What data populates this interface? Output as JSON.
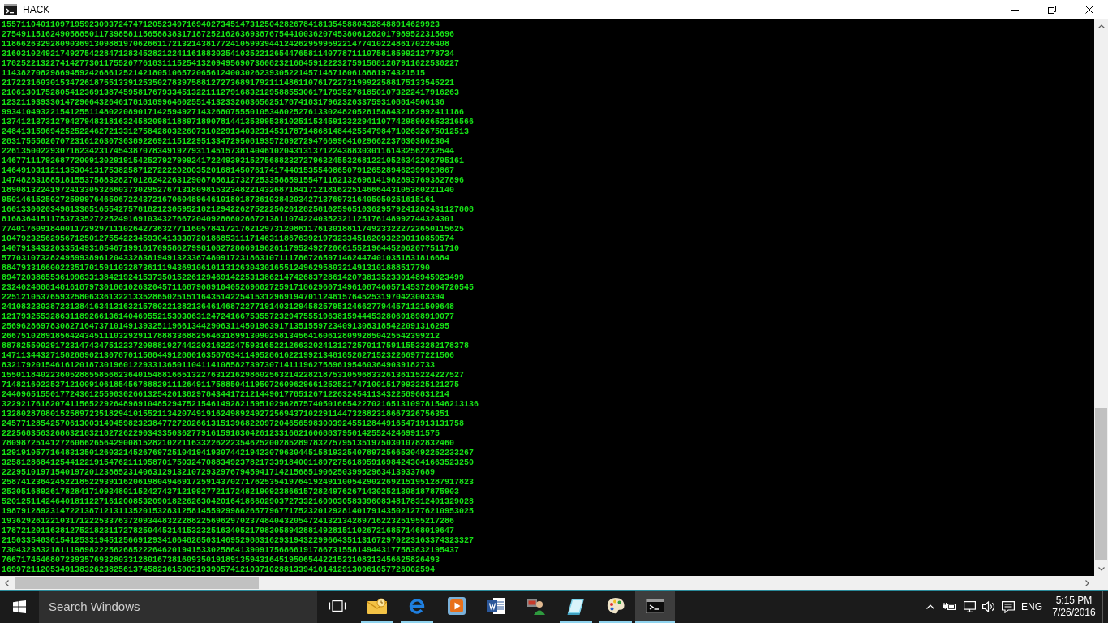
{
  "window": {
    "title": "HACK"
  },
  "console": {
    "lines": [
      "155711040110971959230937247471205234971694027345147312504282678418135458804328488914629923",
      "275491151624905885011739858115658838317187252162636938767544100362074538061282017989522315696",
      "11866263292809036913098819706266117213214381772410599394412426295995922147741022486170226408",
      "316031024921749275422847128345282122411618830354103522126544765811407787111075818599212778734",
      "1782522132274142773011755207761831115254132094956907360823216845912223275915881287911022530227",
      "114382708298694592426861252142180510657206561240030262393052214571487180618881974321515",
      "217223160301534726187551339125350278397588127273689179211148611076172273199922588175133545221",
      "2106130175280541236913874595817679334513221112791683212958855306171793527818501073222417916263",
      "1232119393301472906432646178181899646025514132332683656251787418317962320337593108814506136",
      "99341049322154125511480220890171425949271432680755501053480252761330248205281588432182992411186",
      "1374121373127942794831816324582098118897189078144135399538102511534591332294110774298902653316566",
      "248413159694252522462721331275842803226073102291340323145317871486814844255479847102632675012513",
      "28317555020707231612630730389226921151229513347295081935728927294766996410296622378303862304",
      "226135002293071623423174543870783491927931145157381404610204313137122438830301161432562232544",
      "14677111792687720091302919154252792799924172249393152756882327279632455326812210526342202795161",
      "146491031121135304131753825871272222020035201681450761741744015355408650791265289462399929867",
      "14748283188518155375883282701262422631290878561273272533588591554711621326961419828937693827896",
      "189081322419724133053266037302952767131809815323482214326871841712181622514666443105380221140",
      "95014615250272599976465067224372167060489646101801873610384203427137697316405050251615161",
      "1601330020349813385165542757818212305952182129422627522250201282581025965103629579241282431127808",
      "816836415117537335272252491691034327667204092866026672138110742240352321125176148992744324301",
      "77401760918400117292971110264273632771160578417217621297312086117613018811749233222722650115625",
      "104792325629567125012755422345930413330720186853111714631186763921973233451620932290110859574",
      "1407913432203351493185467199101709586279981082728069196261179524927206615521964452062077511710",
      "57703107328249599389612043328361949132336748091723186310711178672659714624474010351831816684",
      "8847933166002235170159110328736111943691061011312630430165512496295803214913101888517790",
      "89472038655361996331384219241537350152261294691422531386214742683728614207381352330148945923499",
      "2324024888148161879730180102632045711687908910405269602725917186296071496108746057145372804720545",
      "2251210537659325806336132213352865025151164351422541531296919470112461576452531970423003394",
      "241083230387231384163413163215780221382136461468722771914031294582579512466277944571121509648",
      "121793255328631189266136140469552153030631247241667535572329475551963815944453280691898919077",
      "25696286978308271647371014913932511966134429063114501963917135155972340913083185422091316295",
      "266751028918564243451110329291178883368825646318991309025813456416061280992850425542399212",
      "887825500291723147434751223720988192744220316222475931652212663202413127257011759115533282178378",
      "147113443271582889021307870115884491288016358763411495286162219921348185282715232266977221506",
      "83217920154616120187301960122933136501104114108582739730714111962758961954603649039182733",
      "15501184022360528855856623640154881665132276312162986025632142282187531059683326136115224227527",
      "7148216022537121009106185456788829111264911758850411950726096296612525217471001517993225121275",
      "24409651550177243612559030266132542013829784344172121449017785126712263245411343225896831214",
      "32292176182074115652292648989104852947521546149282159510296287574050166542270216513109781546213136",
      "13280287080152589723518294101552113420749191624989249272569437102291144732882318667326756351",
      "24577128542570613003149459823238477272026613151396822097204656598300392455128449165471913131758",
      "222568356326863218321827262290343350362779161591830426123316821606883795014255242469911575",
      "780987251412726066265642900815282102211633226222354625200285289783275795135197503010782832460",
      "1291910577164831350126032145267697251041941930744219423079630445158193254078972566530492252233267",
      "3258128684125441221915476211195870175032470883492378217339184001189727561895916984243041663523250",
      "22295101971540197201238852314063129132107293297679459417142156851906250399529634139337689",
      "2587412364245221852293911620619804946917259143702717625354197641924911005429022692151951287917823",
      "2530516892617828417109348011524274371219927721172482190923866157282497626714302521308187875903",
      "5201251142464018112271612008532090182262630420164186602903727332160903058339608348178312491329028",
      "1987912892314722138712131135201532831258145592998626577967717523201292814017914350212776210953025",
      "193629261221031712225337637209344832228822569629702374840432054724132134289716223251955217286",
      "178721201163812752182311727825044531415323251634052179830589428814928151102672168571468019647",
      "2150335403015412533194512566912934186482850314695298831629319432299664351131672970223163374323327",
      "7304323832181119898222562685222646201941533025864139091756866191786731558149443177583632195437",
      "766717454680723935769328033128016738160935019189135943164519506544221523108313456625826493",
      "16997211205349138326238256137458236159031939057412103710288133941014129130961057726002594"
    ]
  },
  "taskbar": {
    "search": {
      "placeholder": "Search Windows"
    },
    "apps": [
      {
        "kind": "taskview",
        "running": false,
        "selected": false
      },
      {
        "kind": "envelope",
        "running": true,
        "selected": false
      },
      {
        "kind": "browser",
        "running": true,
        "selected": false
      },
      {
        "kind": "player",
        "running": false,
        "selected": false
      },
      {
        "kind": "document",
        "running": false,
        "selected": false
      },
      {
        "kind": "person",
        "running": false,
        "selected": false
      },
      {
        "kind": "notepad",
        "running": true,
        "selected": false
      },
      {
        "kind": "palette",
        "running": true,
        "selected": false
      },
      {
        "kind": "terminal",
        "running": true,
        "selected": true
      }
    ],
    "tray": {
      "language": "ENG",
      "time": "5:15 PM",
      "date": "7/26/2016"
    }
  }
}
